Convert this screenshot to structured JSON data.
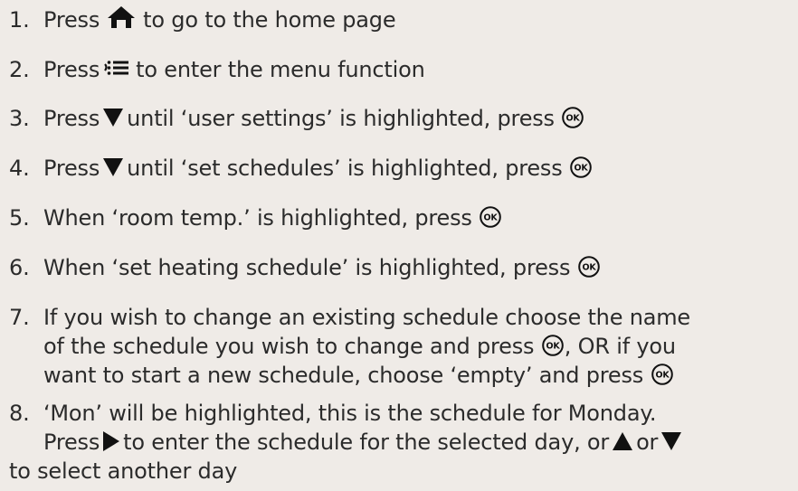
{
  "steps": [
    {
      "num": "1.",
      "parts": [
        "Press",
        "to go to the home page"
      ]
    },
    {
      "num": "2.",
      "parts": [
        "Press",
        "to enter the menu function"
      ]
    },
    {
      "num": "3.",
      "parts": [
        "Press",
        "until ‘user settings’ is highlighted, press"
      ]
    },
    {
      "num": "4.",
      "parts": [
        "Press",
        "until ‘set schedules’ is highlighted, press"
      ]
    },
    {
      "num": "5.",
      "parts": [
        "When ‘room temp.’ is highlighted, press"
      ]
    },
    {
      "num": "6.",
      "parts": [
        "When ‘set heating schedule’ is highlighted, press"
      ]
    },
    {
      "num": "7.",
      "lines": [
        [
          "If you wish to change an existing schedule choose the name"
        ],
        [
          "of the schedule you wish to change and press",
          ", OR if you"
        ],
        [
          "want to start a new schedule, choose ‘empty’ and press"
        ]
      ]
    },
    {
      "num": "8.",
      "lines": [
        [
          "‘Mon’ will be highlighted, this is the schedule for Monday."
        ],
        [
          "Press",
          "to enter the schedule for the selected day, or",
          "or"
        ],
        [
          "to select another day"
        ]
      ]
    }
  ],
  "icons": {
    "home": "home-icon",
    "menu": "menu-icon",
    "down": "down-arrow-icon",
    "up": "up-arrow-icon",
    "right": "right-arrow-icon",
    "ok": "ok-button-icon",
    "ok_label": "OK"
  },
  "colors": {
    "background": "#efebe7",
    "text": "#2b2b2b"
  }
}
